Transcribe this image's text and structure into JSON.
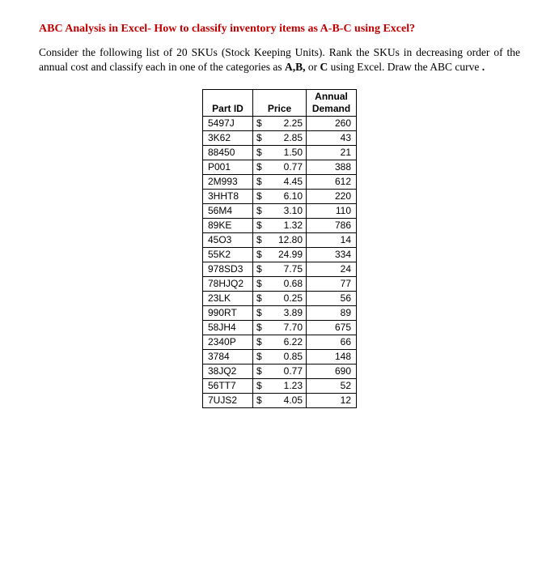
{
  "title": "ABC Analysis in Excel- How to classify inventory items as A-B-C using Excel?",
  "intro_parts": {
    "p1": "Consider the following list of 20 SKUs (Stock Keeping Units). Rank the SKUs in decreasing order of the annual cost and classify each in one of the categories as ",
    "abc": "A,B,",
    "p2": " or ",
    "c": "C",
    "p3": " using Excel. Draw the ABC curve ",
    "dot": "."
  },
  "headers": {
    "partid": "Part ID",
    "price": "Price",
    "demand": "Annual Demand"
  },
  "currency": "$",
  "rows": [
    {
      "id": "5497J",
      "price": "2.25",
      "demand": "260"
    },
    {
      "id": "3K62",
      "price": "2.85",
      "demand": "43"
    },
    {
      "id": "88450",
      "price": "1.50",
      "demand": "21"
    },
    {
      "id": "P001",
      "price": "0.77",
      "demand": "388"
    },
    {
      "id": "2M993",
      "price": "4.45",
      "demand": "612"
    },
    {
      "id": "3HHT8",
      "price": "6.10",
      "demand": "220"
    },
    {
      "id": "56M4",
      "price": "3.10",
      "demand": "110"
    },
    {
      "id": "89KE",
      "price": "1.32",
      "demand": "786"
    },
    {
      "id": "45O3",
      "price": "12.80",
      "demand": "14"
    },
    {
      "id": "55K2",
      "price": "24.99",
      "demand": "334"
    },
    {
      "id": "978SD3",
      "price": "7.75",
      "demand": "24"
    },
    {
      "id": "78HJQ2",
      "price": "0.68",
      "demand": "77"
    },
    {
      "id": "23LK",
      "price": "0.25",
      "demand": "56"
    },
    {
      "id": "990RT",
      "price": "3.89",
      "demand": "89"
    },
    {
      "id": "58JH4",
      "price": "7.70",
      "demand": "675"
    },
    {
      "id": "2340P",
      "price": "6.22",
      "demand": "66"
    },
    {
      "id": "3784",
      "price": "0.85",
      "demand": "148"
    },
    {
      "id": "38JQ2",
      "price": "0.77",
      "demand": "690"
    },
    {
      "id": "56TT7",
      "price": "1.23",
      "demand": "52"
    },
    {
      "id": "7UJS2",
      "price": "4.05",
      "demand": "12"
    }
  ]
}
